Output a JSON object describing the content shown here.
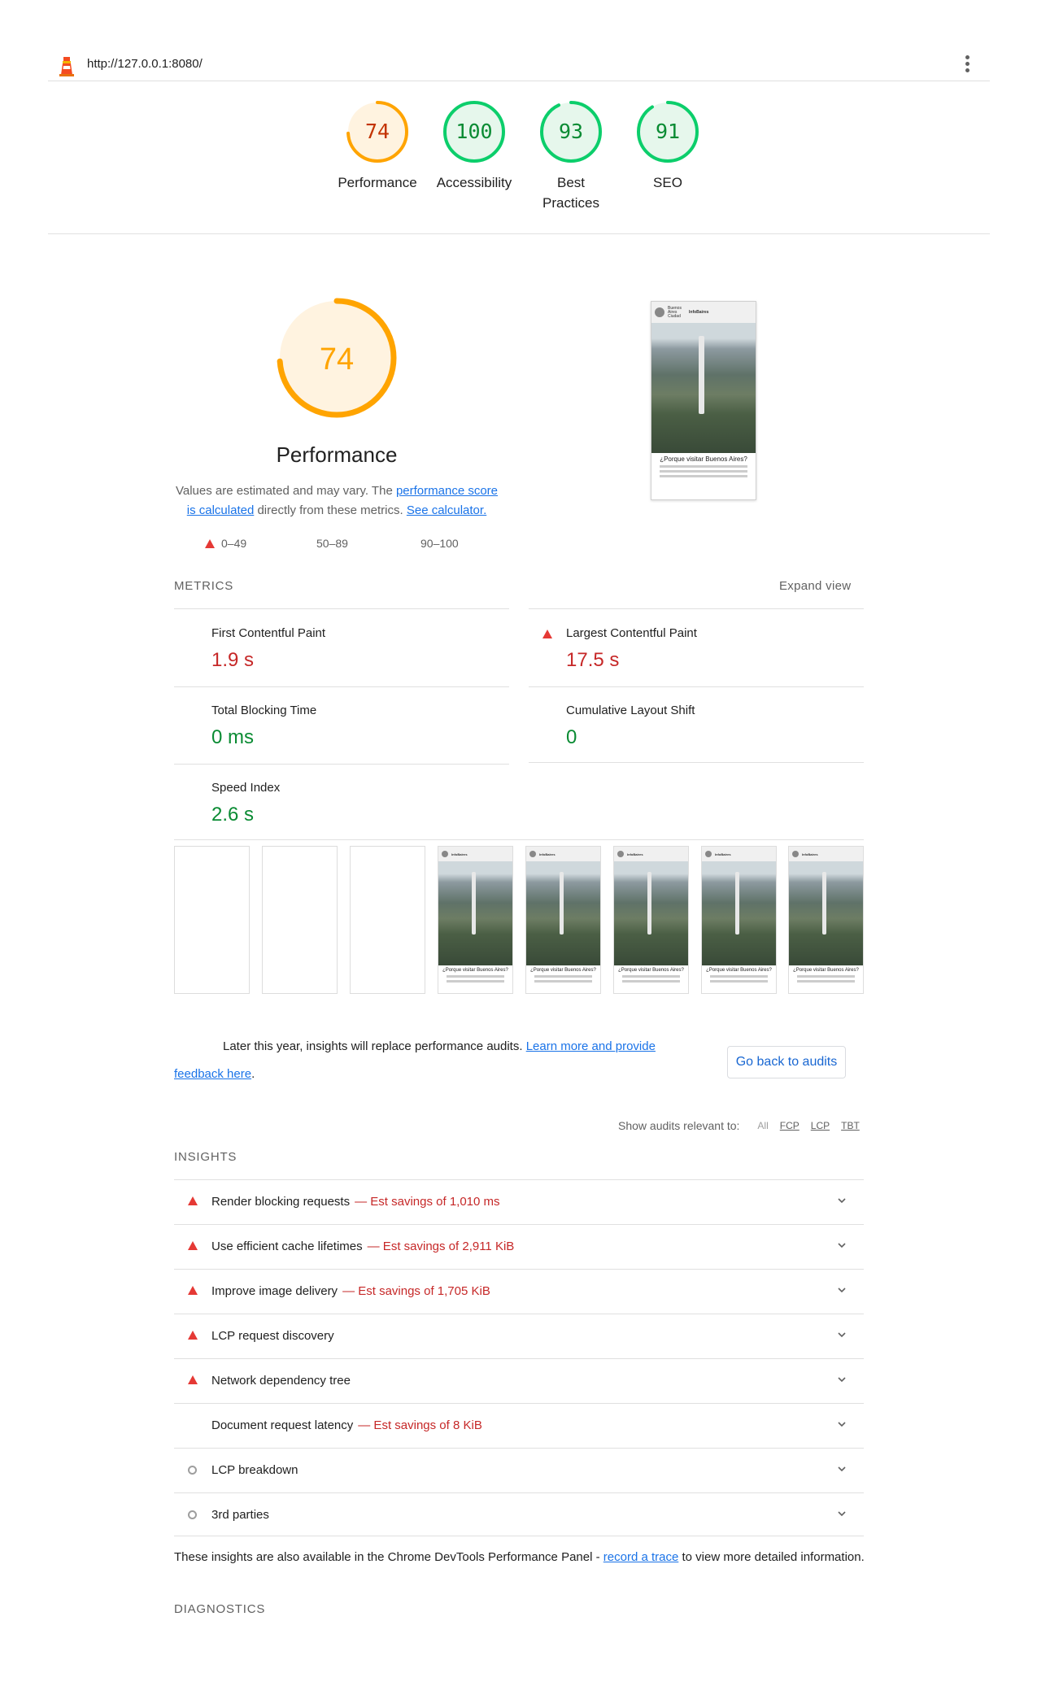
{
  "topbar": {
    "url": "http://127.0.0.1:8080/"
  },
  "gauges": [
    {
      "score": "74",
      "label": "Performance",
      "color": "#ffa400"
    },
    {
      "score": "100",
      "label": "Accessibility",
      "color": "#0cce6b"
    },
    {
      "score": "93",
      "label": "Best Practices",
      "color": "#0cce6b"
    },
    {
      "score": "91",
      "label": "SEO",
      "color": "#0cce6b"
    }
  ],
  "performance": {
    "score": "74",
    "title": "Performance",
    "desc_prefix": "Values are estimated and may vary. The ",
    "desc_link1": "performance score is calculated",
    "desc_mid": " directly from these metrics. ",
    "desc_link2": "See calculator.",
    "legend": [
      "0–49",
      "50–89",
      "90–100"
    ]
  },
  "thumb": {
    "brand": "Buenos Aires Ciudad",
    "site": "InfoBaires",
    "caption": "¿Porque visitar Buenos Aires?"
  },
  "metrics": {
    "heading": "METRICS",
    "expand": "Expand view",
    "items": [
      {
        "name": "First Contentful Paint",
        "value": "1.9 s",
        "status": "average"
      },
      {
        "name": "Largest Contentful Paint",
        "value": "17.5 s",
        "status": "fail"
      },
      {
        "name": "Total Blocking Time",
        "value": "0 ms",
        "status": "pass"
      },
      {
        "name": "Cumulative Layout Shift",
        "value": "0",
        "status": "pass"
      },
      {
        "name": "Speed Index",
        "value": "2.6 s",
        "status": "pass"
      }
    ]
  },
  "callout": {
    "text": "Later this year, insights will replace performance audits. ",
    "link": "Learn more and provide feedback here",
    "end": ".",
    "button": "Go back to audits"
  },
  "filter": {
    "label": "Show audits relevant to:",
    "options": [
      "All",
      "FCP",
      "LCP",
      "TBT"
    ]
  },
  "insights": {
    "heading": "INSIGHTS",
    "items": [
      {
        "title": "Render blocking requests",
        "savings": "— Est savings of 1,010 ms",
        "icon": "fail"
      },
      {
        "title": "Use efficient cache lifetimes",
        "savings": "— Est savings of 2,911 KiB",
        "icon": "fail"
      },
      {
        "title": "Improve image delivery",
        "savings": "— Est savings of 1,705 KiB",
        "icon": "fail"
      },
      {
        "title": "LCP request discovery",
        "savings": "",
        "icon": "fail"
      },
      {
        "title": "Network dependency tree",
        "savings": "",
        "icon": "fail"
      },
      {
        "title": "Document request latency",
        "savings": "— Est savings of 8 KiB",
        "icon": "none"
      },
      {
        "title": "LCP breakdown",
        "savings": "",
        "icon": "info"
      },
      {
        "title": "3rd parties",
        "savings": "",
        "icon": "info"
      }
    ],
    "note_prefix": "These insights are also available in the Chrome DevTools Performance Panel - ",
    "note_link": "record a trace",
    "note_suffix": " to view more detailed information."
  },
  "diagnostics": {
    "heading": "DIAGNOSTICS"
  }
}
